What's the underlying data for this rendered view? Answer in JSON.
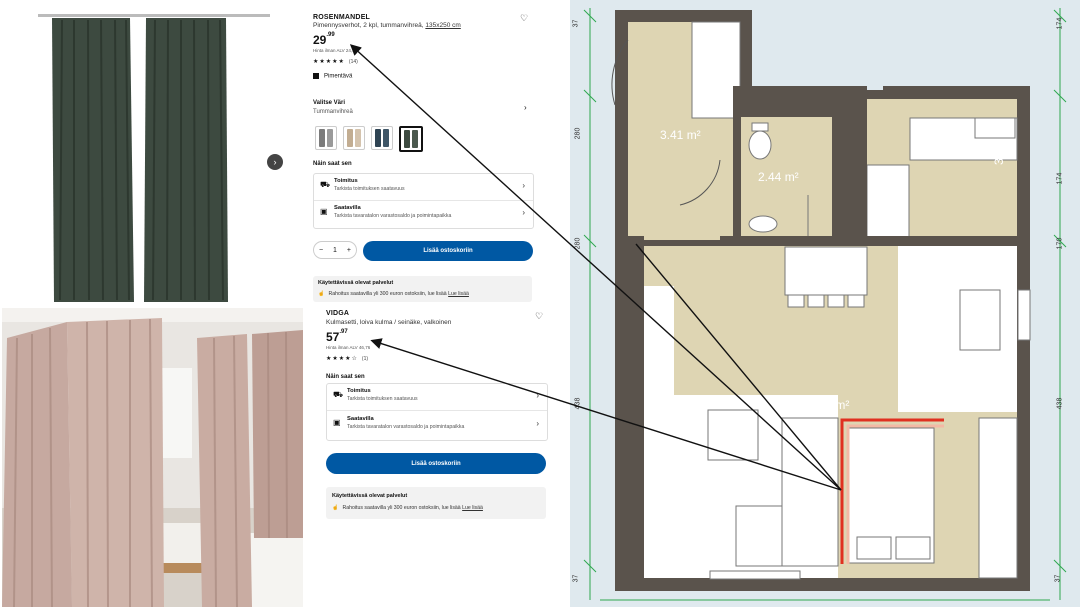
{
  "product1": {
    "name": "ROSENMANDEL",
    "desc": "Pimennysverhot, 2 kpl, tummanvihreä,",
    "size": "135x250 cm",
    "price_int": "29",
    "price_dec": ".99",
    "price_note": "Hinta ilman ALV 24,...",
    "rating_count": "(14)",
    "feature": "Pimentävä",
    "color_label": "Valitse Väri",
    "color_value": "Tummanvihreä",
    "delivery_heading": "Näin saat sen",
    "delivery_title": "Toimitus",
    "delivery_sub": "Tarkista toimituksen saatavuus",
    "available_title": "Saatavilla",
    "available_sub": "Tarkista tavaratalon varastosaldo ja poimintapaikka",
    "qty": "1",
    "qty_minus": "−",
    "qty_plus": "+",
    "add_to_cart": "Lisää ostoskoriin",
    "services_heading": "Käytettävissä olevat palvelut",
    "services_text": "Rahoitus saatavilla yli 300 euron ostoksiin, lue lisää",
    "services_link": "Lue lisää"
  },
  "product2": {
    "name": "VIDGA",
    "desc": "Kulmasetti, loiva kulma / seinäke, valkoinen",
    "price_int": "57",
    "price_dec": ".97",
    "price_note": "Hinta ilman ALV 46,76",
    "rating_count": "(1)",
    "delivery_heading": "Näin saat sen",
    "delivery_title": "Toimitus",
    "delivery_sub": "Tarkista toimituksen saatavuus",
    "available_title": "Saatavilla",
    "available_sub": "Tarkista tavaratalon varastosaldo ja poimintapaikka",
    "add_to_cart": "Lisää ostoskoriin",
    "services_heading": "Käytettävissä olevat palvelut",
    "services_text": "Rahoitus saatavilla yli 300 euron ostoksiin, lue lisää",
    "services_link": "Lue lisää"
  },
  "floorplan": {
    "area_hall": "3.41 m²",
    "area_bath": "2.44 m²",
    "area_kitchen": "3.26 m²",
    "area_living": "24.61 m²",
    "dim_top": "280",
    "dim_left_mid": "280",
    "dim_left_low": "438",
    "dim_left_bot": "37",
    "dim_right_a": "174",
    "dim_right_b": "170",
    "dim_right_c": "438",
    "dim_right_d": "37",
    "dim_left_top": "37"
  },
  "colors": {
    "ikea_blue": "#0058a3",
    "floor_tan": "#ded5b3",
    "wall": "#5a534c",
    "highlight": "#e03020"
  },
  "icons": [
    "heart-icon",
    "chevron-right-icon",
    "truck-icon",
    "store-icon",
    "info-icon",
    "carousel-next-icon"
  ]
}
